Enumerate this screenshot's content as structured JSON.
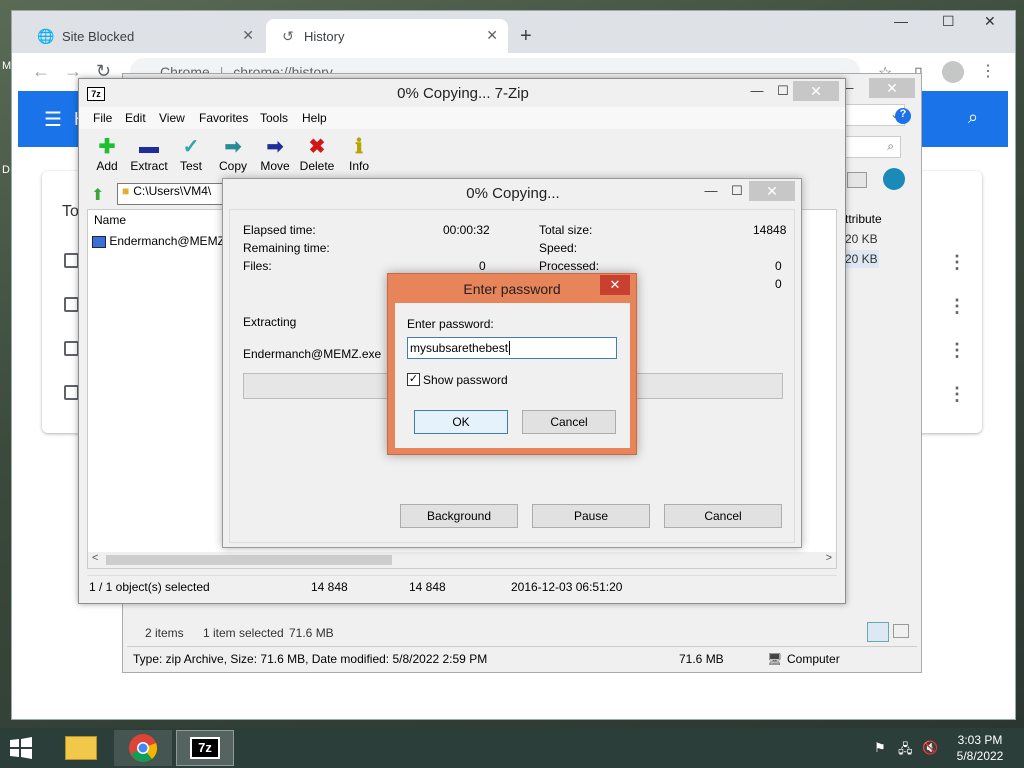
{
  "chrome": {
    "tabs": [
      {
        "label": "Site Blocked",
        "icon": "globe-icon"
      },
      {
        "label": "History",
        "icon": "history-icon"
      }
    ],
    "omnibox": {
      "site": "Chrome",
      "url": "chrome://history"
    },
    "history_header_partial": "H",
    "card_partial": "To"
  },
  "explorer": {
    "status": {
      "items": "2 items",
      "selected": "1 item selected",
      "selected_size": "71.6 MB"
    },
    "details": {
      "text": "Type: zip Archive, Size: 71.6 MB, Date modified: 5/8/2022 2:59 PM",
      "size": "71.6 MB",
      "location": "Computer"
    },
    "sizes": [
      "20 KB",
      "20 KB"
    ],
    "col_partial": "ttribute"
  },
  "sevenzip": {
    "title": "0% Copying... 7-Zip",
    "menu": [
      "File",
      "Edit",
      "View",
      "Favorites",
      "Tools",
      "Help"
    ],
    "toolbar": [
      {
        "label": "Add",
        "icon": "add-icon",
        "color": "#1fbf2f"
      },
      {
        "label": "Extract",
        "icon": "extract-icon",
        "color": "#1d2d9c"
      },
      {
        "label": "Test",
        "icon": "test-icon",
        "color": "#2aa6b0"
      },
      {
        "label": "Copy",
        "icon": "copy-icon",
        "color": "#2a8a9a"
      },
      {
        "label": "Move",
        "icon": "move-icon",
        "color": "#1d2d9c"
      },
      {
        "label": "Delete",
        "icon": "delete-icon",
        "color": "#d01818"
      },
      {
        "label": "Info",
        "icon": "info-icon",
        "color": "#b8a400"
      }
    ],
    "path": "C:\\Users\\VM4\\",
    "column_name": "Name",
    "file": "Endermanch@MEMZ",
    "status": [
      "1 / 1 object(s) selected",
      "14 848",
      "14 848",
      "2016-12-03 06:51:20"
    ]
  },
  "progress": {
    "title": "0% Copying...",
    "elapsed_label": "Elapsed time:",
    "elapsed": "00:00:32",
    "remaining_label": "Remaining time:",
    "files_label": "Files:",
    "files": "0",
    "total_label": "Total size:",
    "total": "14848",
    "speed_label": "Speed:",
    "processed_label": "Processed:",
    "processed": "0",
    "extra": "0",
    "action": "Extracting",
    "filename": "Endermanch@MEMZ.exe",
    "buttons": [
      "Background",
      "Pause",
      "Cancel"
    ]
  },
  "password": {
    "title": "Enter password",
    "label": "Enter password:",
    "value": "mysubsarethebest",
    "show_label": "Show password",
    "show_checked": true,
    "ok": "OK",
    "cancel": "Cancel"
  },
  "taskbar": {
    "time": "3:03 PM",
    "date": "5/8/2022",
    "apps": [
      "file-explorer",
      "chrome",
      "7-zip"
    ]
  },
  "colors": {
    "chrome_blue": "#1a73e8",
    "dialog_accent": "#e8845a",
    "taskbar": "#2c3e3a"
  }
}
